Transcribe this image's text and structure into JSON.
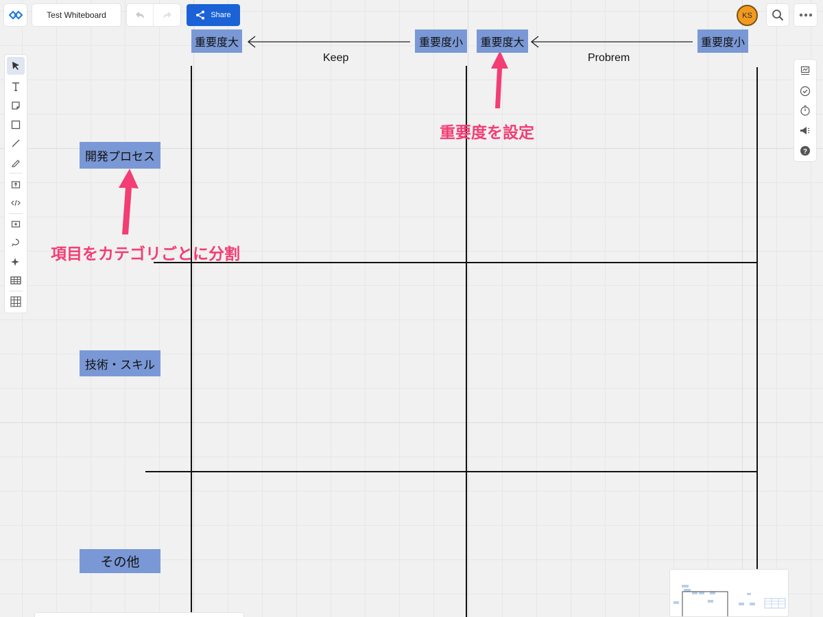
{
  "app": {
    "board_title": "Test Whiteboard",
    "share_label": "Share",
    "avatar_initials": "KS"
  },
  "colors": {
    "accent": "#1a62d6",
    "sticky": "#7a98d5",
    "annotation": "#f33d74",
    "avatar": "#f39a1e"
  },
  "left_toolbar": {
    "tools": [
      "select-icon",
      "text-icon",
      "sticky-note-icon",
      "rectangle-icon",
      "line-icon",
      "pen-icon",
      "upload-icon",
      "embed-code-icon",
      "frame-add-icon",
      "lasso-icon",
      "ai-sparkle-icon",
      "table-icon",
      "grid-icon"
    ]
  },
  "right_toolbar": {
    "tools": [
      "presentation-icon",
      "checklist-icon",
      "timer-icon",
      "announce-icon",
      "help-icon"
    ]
  },
  "board": {
    "importance_labels": [
      "重要度大",
      "重要度小",
      "重要度大",
      "重要度小"
    ],
    "column_headers": [
      "Keep",
      "Probrem"
    ],
    "categories": [
      "開発プロセス",
      "技術・スキル",
      "その他"
    ],
    "annotations": [
      "重要度を設定",
      "項目をカテゴリごとに分割"
    ]
  }
}
